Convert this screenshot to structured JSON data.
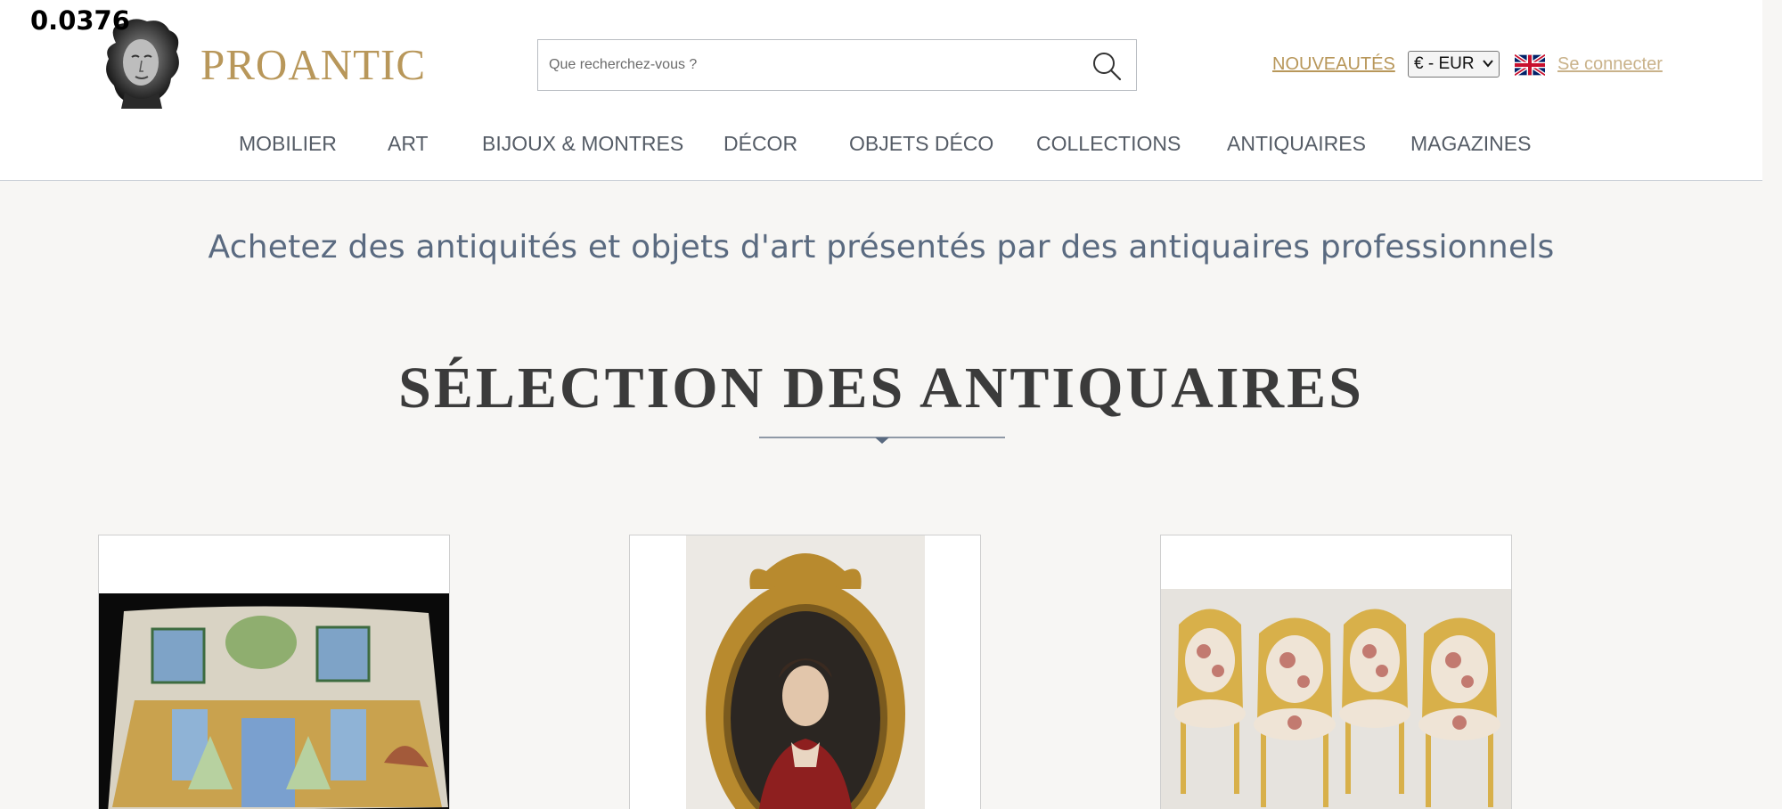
{
  "overlay": {
    "value": "0.0376"
  },
  "brand": {
    "name": "PROANTIC"
  },
  "search": {
    "placeholder": "Que recherchez-vous ?"
  },
  "header": {
    "new_label": "NOUVEAUTÉS",
    "currency": "€ - EUR",
    "login": "Se connecter"
  },
  "nav": {
    "items": [
      {
        "label": "MOBILIER"
      },
      {
        "label": "ART"
      },
      {
        "label": "BIJOUX & MONTRES"
      },
      {
        "label": "DÉCOR"
      },
      {
        "label": "OBJETS DÉCO"
      },
      {
        "label": "COLLECTIONS"
      },
      {
        "label": "ANTIQUAIRES"
      },
      {
        "label": "MAGAZINES"
      }
    ]
  },
  "main": {
    "tagline": "Achetez des antiquités et objets d'art présentés par des antiquaires professionnels",
    "section_title": "SÉLECTION DES ANTIQUAIRES"
  },
  "colors": {
    "gold": "#b8975a",
    "nav_text": "#555c66",
    "tagline": "#5a6a80",
    "background": "#f7f6f4"
  },
  "icons": [
    "bust-logo-icon",
    "search-icon",
    "chevron-down-icon",
    "uk-flag-icon"
  ]
}
